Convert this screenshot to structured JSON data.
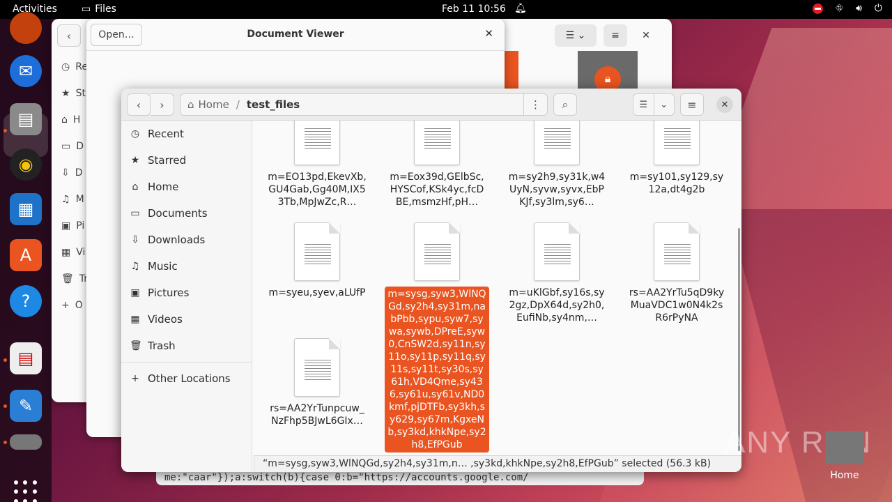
{
  "topbar": {
    "activities": "Activities",
    "app_name": "Files",
    "clock": "Feb 11  10:56"
  },
  "dock": {
    "items": [
      "firefox-icon",
      "thunderbird-icon",
      "files-icon",
      "rhythmbox-icon",
      "writer-icon",
      "app-center-icon",
      "help-icon",
      "document-viewer-icon",
      "text-editor-icon",
      "disk-icon",
      "show-apps-icon"
    ]
  },
  "bg_window": {
    "sidebar_letters": [
      "Re",
      "St",
      "H",
      "D",
      "D",
      "M",
      "Pi",
      "Vi",
      "Tr",
      "O"
    ]
  },
  "document_viewer": {
    "open_label": "Open…",
    "title": "Document Viewer"
  },
  "code_strip": "me:\"caar\"});a:switch(b){case 0:b=\"https://accounts.google.com/",
  "files": {
    "path_home": "Home",
    "path_current": "test_files",
    "sidebar": [
      {
        "label": "Recent",
        "icon": "clock-icon"
      },
      {
        "label": "Starred",
        "icon": "star-icon"
      },
      {
        "label": "Home",
        "icon": "home-icon"
      },
      {
        "label": "Documents",
        "icon": "documents-icon"
      },
      {
        "label": "Downloads",
        "icon": "downloads-icon"
      },
      {
        "label": "Music",
        "icon": "music-icon"
      },
      {
        "label": "Pictures",
        "icon": "pictures-icon"
      },
      {
        "label": "Videos",
        "icon": "videos-icon"
      },
      {
        "label": "Trash",
        "icon": "trash-icon"
      }
    ],
    "other_locations": "Other Locations",
    "items": [
      {
        "name": "m=EO13pd,EkevXb,GU4Gab,Gg40M,IX53Tb,MpJwZc,R…"
      },
      {
        "name": "m=Eox39d,GElbSc,HYSCof,KSk4yc,fcDBE,msmzHf,pH…"
      },
      {
        "name": "m=sy2h9,sy31k,w4UyN,syvw,syvx,EbPKJf,sy3lm,sy6…"
      },
      {
        "name": "m=sy101,sy129,sy12a,dt4g2b"
      },
      {
        "name": "m=syeu,syev,aLUfP"
      },
      {
        "name": "m=sysg,syw3,WlNQGd,sy2h4,sy31m,nabPbb,sypu,syw7,sywa,sywb,DPreE,syw0,CnSW2d,sy11n,sy11o,sy11p,sy11q,sy11s,sy11t,sy30s,sy61h,VD4Qme,sy436,sy61u,sy61v,ND0kmf,pjDTFb,sy3kh,sy629,sy67m,KgxeNb,sy3kd,khkNpe,sy2h8,EfPGub",
        "selected": true
      },
      {
        "name": "m=uKlGbf,sy16s,sy2gz,DpX64d,sy2h0,EufiNb,sy4nm,…"
      },
      {
        "name": "rs=AA2YrTu5qD9kyMuaVDC1w0N4k2sR6rPyNA"
      },
      {
        "name": "rs=AA2YrTunpcuw_NzFhp5BJwL6GIx…"
      }
    ],
    "status": "“m=sysg,syw3,WlNQGd,sy2h4,sy31m,n… ,sy3kd,khkNpe,sy2h8,EfPGub” selected  (56.3 kB)"
  },
  "desktop": {
    "home_label": "Home",
    "watermark": "ANY RUN"
  }
}
